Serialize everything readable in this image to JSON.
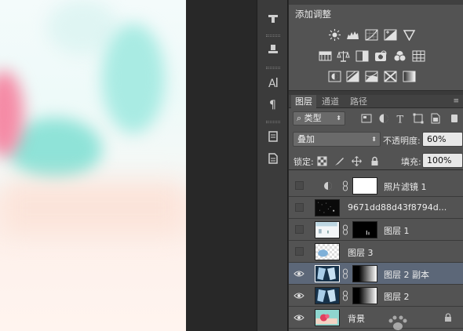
{
  "adjustments": {
    "title": "添加调整"
  },
  "layers_panel": {
    "tabs": [
      "图层",
      "通道",
      "路径"
    ],
    "filter_kind": "类型",
    "blend_mode": "叠加",
    "opacity_label": "不透明度:",
    "opacity_value": "60%",
    "lock_label": "锁定:",
    "fill_label": "填充:",
    "fill_value": "100%",
    "layers": [
      {
        "name": "照片滤镜 1",
        "visible": false,
        "selected": false
      },
      {
        "name": "9671dd88d43f8794d...",
        "visible": false,
        "selected": false
      },
      {
        "name": "图层 1",
        "visible": false,
        "selected": false
      },
      {
        "name": "图层 3",
        "visible": false,
        "selected": false
      },
      {
        "name": "图层 2 副本",
        "visible": true,
        "selected": true
      },
      {
        "name": "图层 2",
        "visible": true,
        "selected": false
      },
      {
        "name": "背景",
        "visible": true,
        "selected": false,
        "locked": true
      }
    ]
  },
  "icons": {
    "tool_strip": [
      "history-brush-icon",
      "clone-source-icon",
      "character-icon",
      "paragraph-icon",
      "notes-icon",
      "properties-icon"
    ],
    "adjustments_row1": [
      "brightness-icon",
      "levels-icon",
      "curves-icon",
      "exposure-icon",
      "vibrance-icon"
    ],
    "adjustments_row2": [
      "hue-saturation-icon",
      "color-balance-icon",
      "black-white-icon",
      "photo-filter-icon",
      "channel-mixer-icon",
      "color-lookup-icon"
    ],
    "adjustments_row3": [
      "invert-icon",
      "posterize-icon",
      "threshold-icon",
      "selective-color-icon",
      "gradient-map-icon"
    ]
  },
  "colors": {
    "panel_bg": "#535353",
    "selected_layer": "#5c6778",
    "canvas_bg": "#282828"
  }
}
